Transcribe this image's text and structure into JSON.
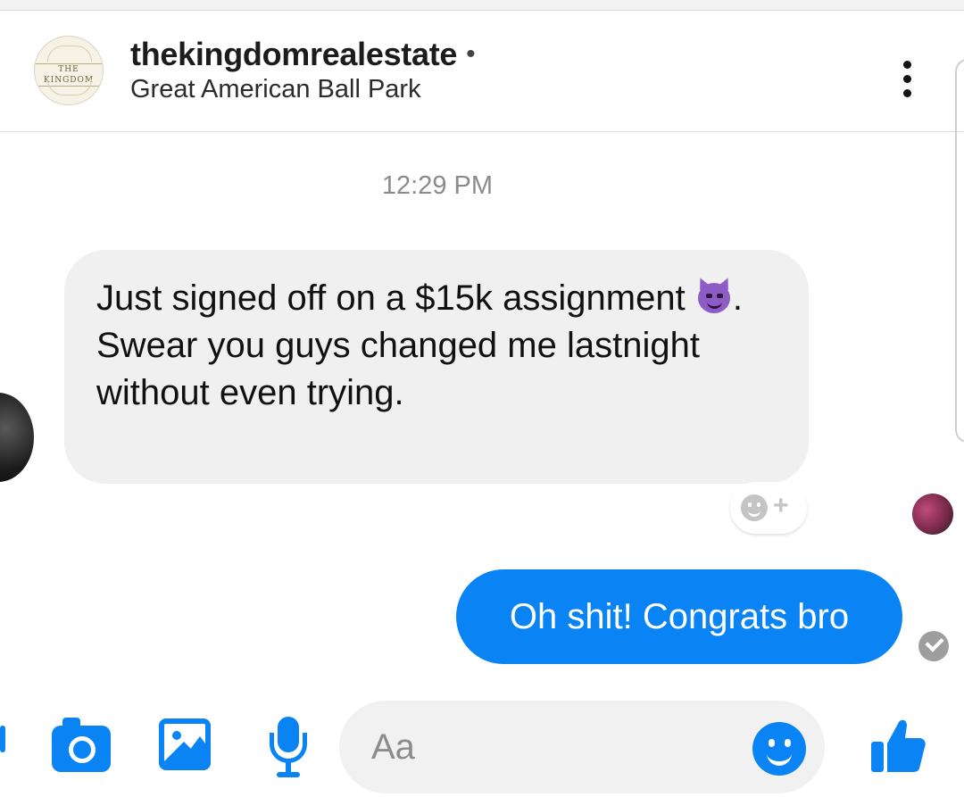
{
  "header": {
    "avatar_logo_text": "THE KINGDOM",
    "username": "thekingdomrealestate",
    "status_dot": "•",
    "location": "Great American Ball Park",
    "menu_icon": "more-vertical-icon"
  },
  "conversation": {
    "timestamp": "12:29 PM",
    "incoming_message": {
      "text_before_emoji": "Just signed off on a $15k assignment ",
      "emoji": "smiling-devil-emoji",
      "text_after_emoji": ". Swear you guys changed me lastnight without even trying."
    },
    "reaction_button": {
      "icon": "smiley-add-reaction-icon",
      "plus": "+"
    },
    "outgoing_message": {
      "text": "Oh shit! Congrats bro"
    },
    "delivered_status_icon": "check-circle-icon"
  },
  "composer": {
    "placeholder": "Aa",
    "icons": [
      "camera-icon",
      "image-icon",
      "microphone-icon",
      "emoji-icon",
      "thumbs-up-icon"
    ]
  },
  "colors": {
    "accent": "#0a84f5",
    "incoming_bubble": "#f0f0f0",
    "timestamp": "#8b8b8b"
  }
}
